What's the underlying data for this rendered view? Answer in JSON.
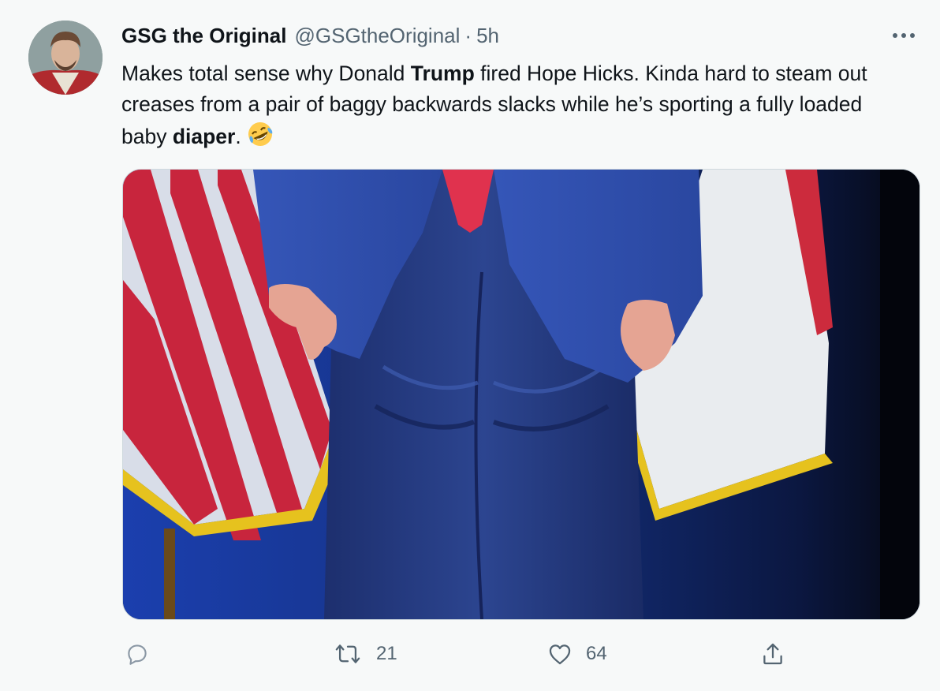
{
  "author": {
    "display_name": "GSG the Original",
    "handle": "@GSGtheOriginal",
    "separator": "·",
    "time": "5h"
  },
  "tweet": {
    "text_1": "Makes total sense why Donald ",
    "bold_1": "Trump",
    "text_2": " fired Hope Hicks. Kinda hard to steam out creases from a pair of baggy backwards slacks while he’s sporting a fully loaded baby ",
    "bold_2": "diaper",
    "text_3": ".",
    "emoji": "rolling-on-floor-laughing-emoji"
  },
  "actions": {
    "reply": {
      "icon": "reply-icon",
      "count": ""
    },
    "retweet": {
      "icon": "retweet-icon",
      "count": "21"
    },
    "like": {
      "icon": "heart-icon",
      "count": "64"
    },
    "share": {
      "icon": "share-icon"
    }
  },
  "colors": {
    "background": "#f7f9f9",
    "text_primary": "#0f1419",
    "text_secondary": "#536471",
    "media_border": "#cfd9de"
  }
}
